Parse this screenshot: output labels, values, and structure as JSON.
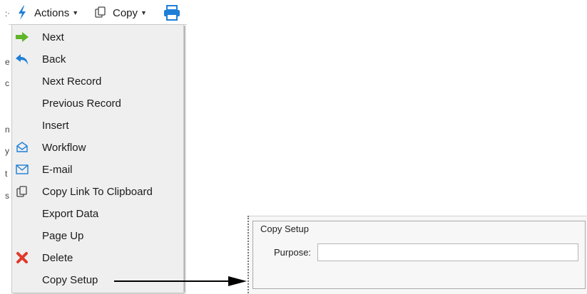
{
  "toolbar": {
    "actions_label": "Actions",
    "copy_label": "Copy",
    "actions_icon": "lightning-bolt-icon",
    "copy_icon": "copy-pages-icon",
    "print_icon": "printer-icon"
  },
  "background_fragments": [
    ":",
    "e",
    "c",
    "n",
    "y",
    "t",
    "s"
  ],
  "menu": {
    "items": [
      {
        "label": "Next",
        "icon": "arrow-right-icon"
      },
      {
        "label": "Back",
        "icon": "back-arrow-icon"
      },
      {
        "label": "Next Record",
        "icon": ""
      },
      {
        "label": "Previous Record",
        "icon": ""
      },
      {
        "label": "Insert",
        "icon": ""
      },
      {
        "label": "Workflow",
        "icon": "workflow-envelope-icon"
      },
      {
        "label": "E-mail",
        "icon": "email-icon"
      },
      {
        "label": "Copy Link To Clipboard",
        "icon": "copy-link-icon"
      },
      {
        "label": "Export Data",
        "icon": ""
      },
      {
        "label": "Page Up",
        "icon": ""
      },
      {
        "label": "Delete",
        "icon": "delete-x-icon"
      },
      {
        "label": "Copy Setup",
        "icon": ""
      }
    ]
  },
  "panel": {
    "legend": "Copy Setup",
    "purpose_label": "Purpose:",
    "purpose_value": ""
  },
  "colors": {
    "accent_blue": "#1f7fd6",
    "next_green": "#5fb52a",
    "delete_red": "#e0392b",
    "menu_bg": "#efefef"
  }
}
